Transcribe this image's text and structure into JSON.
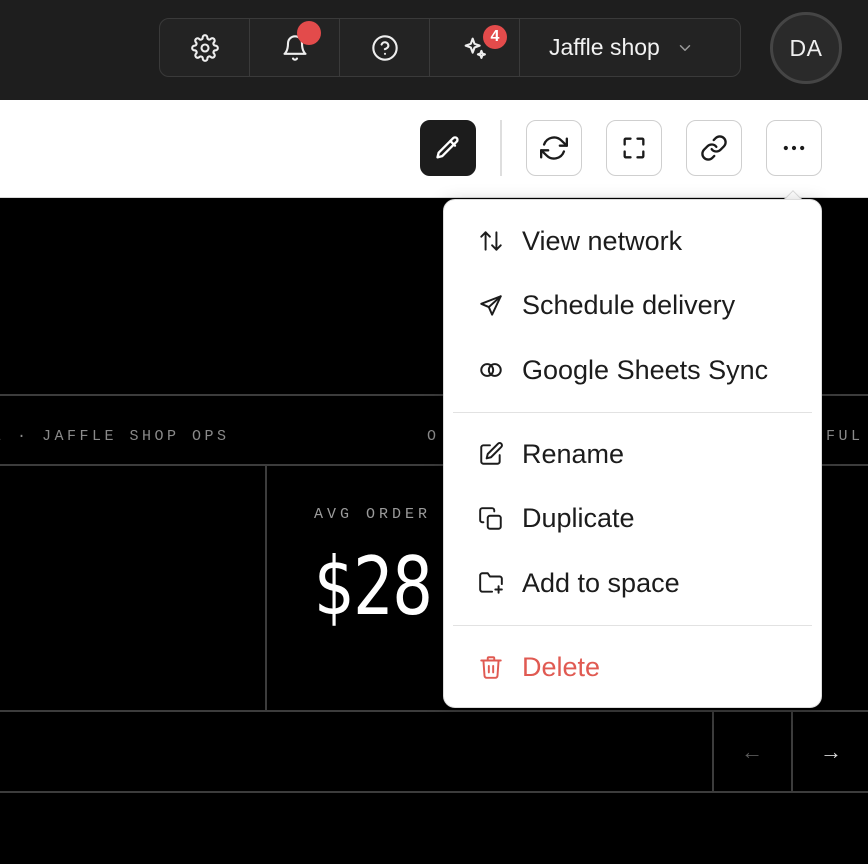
{
  "header": {
    "tools": [
      {
        "name": "settings",
        "icon": "gear-icon"
      },
      {
        "name": "notifications",
        "icon": "bell-icon",
        "has_unread_dot": true
      },
      {
        "name": "help",
        "icon": "help-circle-icon"
      },
      {
        "name": "ai-assistant",
        "icon": "sparkles-icon",
        "badge": "4"
      }
    ],
    "org_name": "Jaffle shop",
    "avatar_initials": "DA"
  },
  "toolbar": {
    "buttons": [
      {
        "name": "edit",
        "icon": "pencil-icon"
      },
      {
        "name": "refresh",
        "icon": "refresh-icon"
      },
      {
        "name": "fullscreen",
        "icon": "fullscreen-icon"
      },
      {
        "name": "copy-link",
        "icon": "link-icon"
      },
      {
        "name": "more",
        "icon": "more-horizontal-icon"
      }
    ]
  },
  "dashboard": {
    "ticker_left": "E · JAFFLE SHOP OPS",
    "ticker_mid": "O",
    "ticker_right": "FUL",
    "kpi_label": "AVG ORDER",
    "kpi_value": "$28",
    "pager_prev": "←",
    "pager_next": "→"
  },
  "menu": {
    "group1": [
      {
        "label": "View network",
        "icon": "arrows-up-down-icon"
      },
      {
        "label": "Schedule delivery",
        "icon": "send-icon"
      },
      {
        "label": "Google Sheets Sync",
        "icon": "rings-icon"
      }
    ],
    "group2": [
      {
        "label": "Rename",
        "icon": "edit-icon"
      },
      {
        "label": "Duplicate",
        "icon": "copy-icon"
      },
      {
        "label": "Add to space",
        "icon": "folder-plus-icon"
      }
    ],
    "group3": [
      {
        "label": "Delete",
        "icon": "trash-icon"
      }
    ]
  },
  "colors": {
    "header_bg": "#1e1e1e",
    "badge_red": "#e34b4b",
    "danger": "#e05a52",
    "edit_button_bg": "#1c1c1c"
  }
}
